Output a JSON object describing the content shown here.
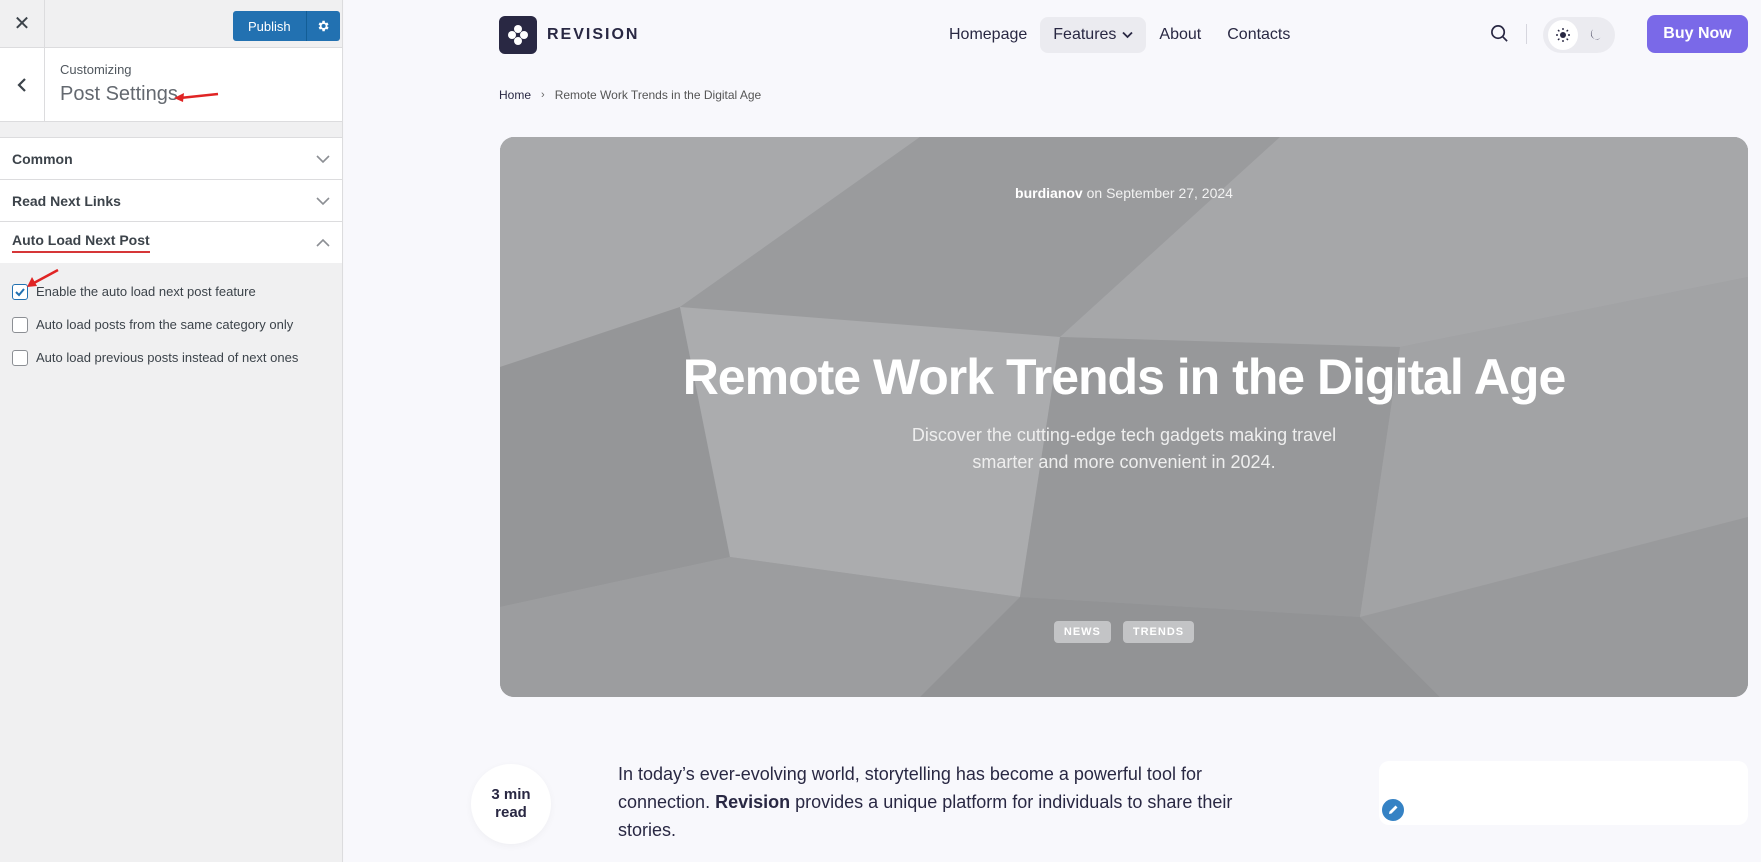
{
  "customizer": {
    "publish_label": "Publish",
    "customizing_label": "Customizing",
    "panel_title": "Post Settings",
    "sections": [
      {
        "label": "Common",
        "expanded": false
      },
      {
        "label": "Read Next Links",
        "expanded": false
      },
      {
        "label": "Auto Load Next Post",
        "expanded": true
      }
    ],
    "options": [
      {
        "label": "Enable the auto load next post feature",
        "checked": true
      },
      {
        "label": "Auto load posts from the same category only",
        "checked": false
      },
      {
        "label": "Auto load previous posts instead of next ones",
        "checked": false
      }
    ]
  },
  "site": {
    "logo_text": "REVISION",
    "nav": [
      "Homepage",
      "Features",
      "About",
      "Contacts"
    ],
    "buy_label": "Buy Now",
    "accent_color": "#7a69e8"
  },
  "breadcrumb": {
    "home": "Home",
    "current": "Remote Work Trends in the Digital Age"
  },
  "hero": {
    "author": "burdianov",
    "date_prefix": "on",
    "date": "September 27, 2024",
    "title": "Remote Work Trends in the Digital Age",
    "subtitle": "Discover the cutting-edge tech gadgets making travel smarter and more convenient in 2024.",
    "tags": [
      "NEWS",
      "TRENDS"
    ]
  },
  "article": {
    "read_time_value": "3 min",
    "read_time_unit": "read",
    "intro_before": "In today’s ever-evolving world, storytelling has become a powerful tool for connection.",
    "intro_bold": "Revision",
    "intro_after": "provides a unique platform for individuals to share their stories."
  }
}
